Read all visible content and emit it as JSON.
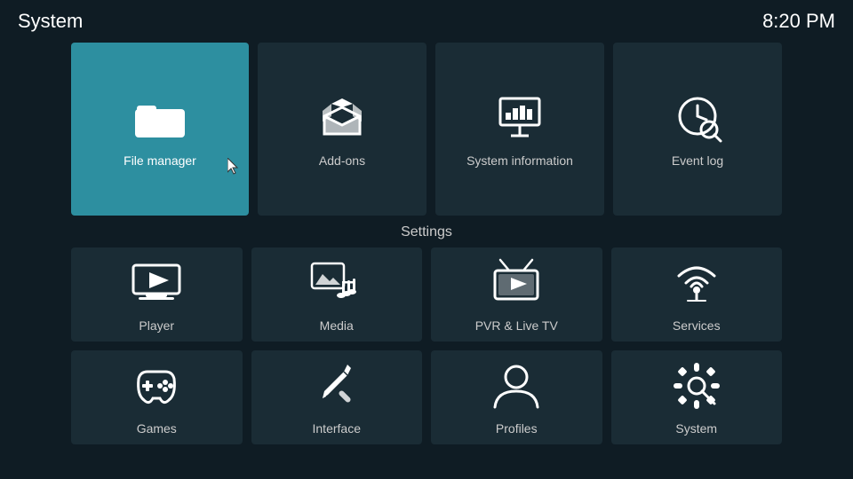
{
  "topBar": {
    "title": "System",
    "clock": "8:20 PM"
  },
  "topRow": {
    "fileManager": {
      "label": "File manager"
    },
    "addOns": {
      "label": "Add-ons"
    },
    "systemInfo": {
      "label": "System information"
    },
    "eventLog": {
      "label": "Event log"
    }
  },
  "settingsLabel": "Settings",
  "settingsGrid": [
    {
      "id": "player",
      "label": "Player"
    },
    {
      "id": "media",
      "label": "Media"
    },
    {
      "id": "pvr",
      "label": "PVR & Live TV"
    },
    {
      "id": "services",
      "label": "Services"
    },
    {
      "id": "games",
      "label": "Games"
    },
    {
      "id": "interface",
      "label": "Interface"
    },
    {
      "id": "profiles",
      "label": "Profiles"
    },
    {
      "id": "system",
      "label": "System"
    }
  ]
}
